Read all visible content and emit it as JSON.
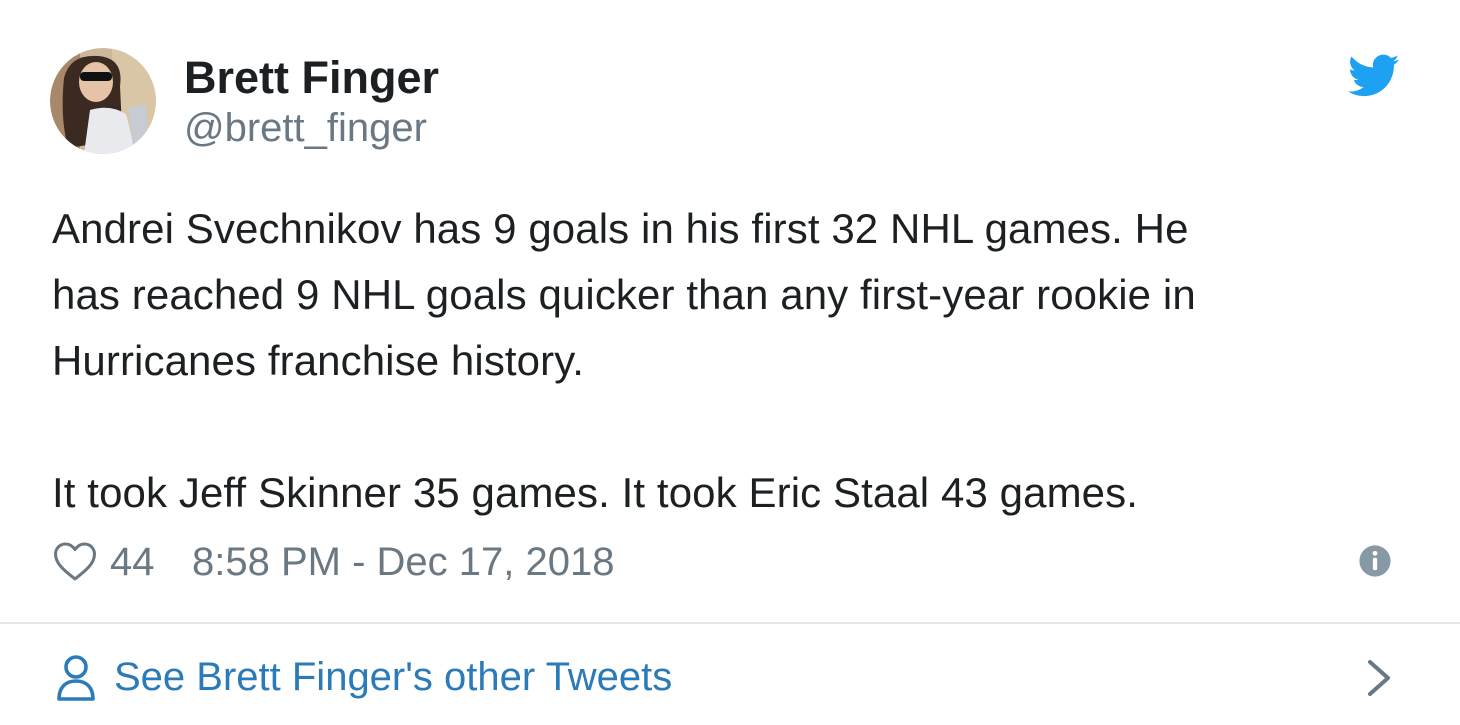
{
  "tweet": {
    "author": {
      "name": "Brett Finger",
      "handle": "@brett_finger"
    },
    "text": "Andrei Svechnikov has 9 goals in his first 32 NHL games. He\nhas reached 9 NHL goals quicker than any first-year rookie in\nHurricanes franchise history.\n\nIt took Jeff Skinner 35 games. It took Eric Staal 43 games.",
    "likes": "44",
    "timestamp": "8:58 PM - Dec 17, 2018"
  },
  "footer": {
    "link_text": "See Brett Finger's other Tweets"
  },
  "icons": {
    "brand": "twitter-bird-icon",
    "like": "heart-icon",
    "info": "info-icon",
    "profile": "person-icon",
    "next": "chevron-right-icon"
  },
  "colors": {
    "twitter_blue": "#1da1f2",
    "link_blue": "#2b7bb9",
    "muted_text": "#697882",
    "body_text": "#1c2022",
    "divider": "#e1e8ed"
  }
}
